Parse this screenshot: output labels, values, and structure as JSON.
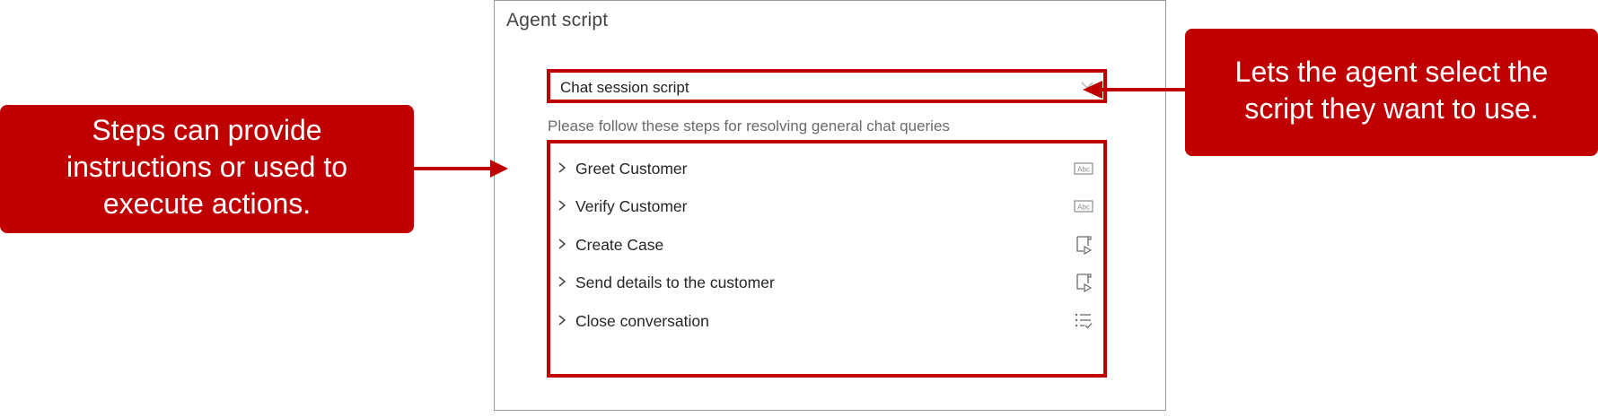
{
  "panel": {
    "title": "Agent script",
    "script_selector": {
      "value": "Chat session script",
      "icon": "chevron-down-icon"
    },
    "instructions": "Please follow these steps for resolving general chat queries",
    "steps": [
      {
        "label": "Greet Customer",
        "icon": "text-abc-icon"
      },
      {
        "label": "Verify Customer",
        "icon": "text-abc-icon"
      },
      {
        "label": "Create Case",
        "icon": "macro-script-icon"
      },
      {
        "label": "Send details to the customer",
        "icon": "macro-script-icon"
      },
      {
        "label": "Close conversation",
        "icon": "checklist-icon"
      }
    ]
  },
  "callouts": {
    "left": [
      "Steps can provide",
      "instructions or used to",
      "execute actions."
    ],
    "right": [
      "Lets the agent select the",
      "script they want to use."
    ]
  },
  "colors": {
    "accent": "#c00000",
    "panel_border": "#9a9a9a"
  }
}
